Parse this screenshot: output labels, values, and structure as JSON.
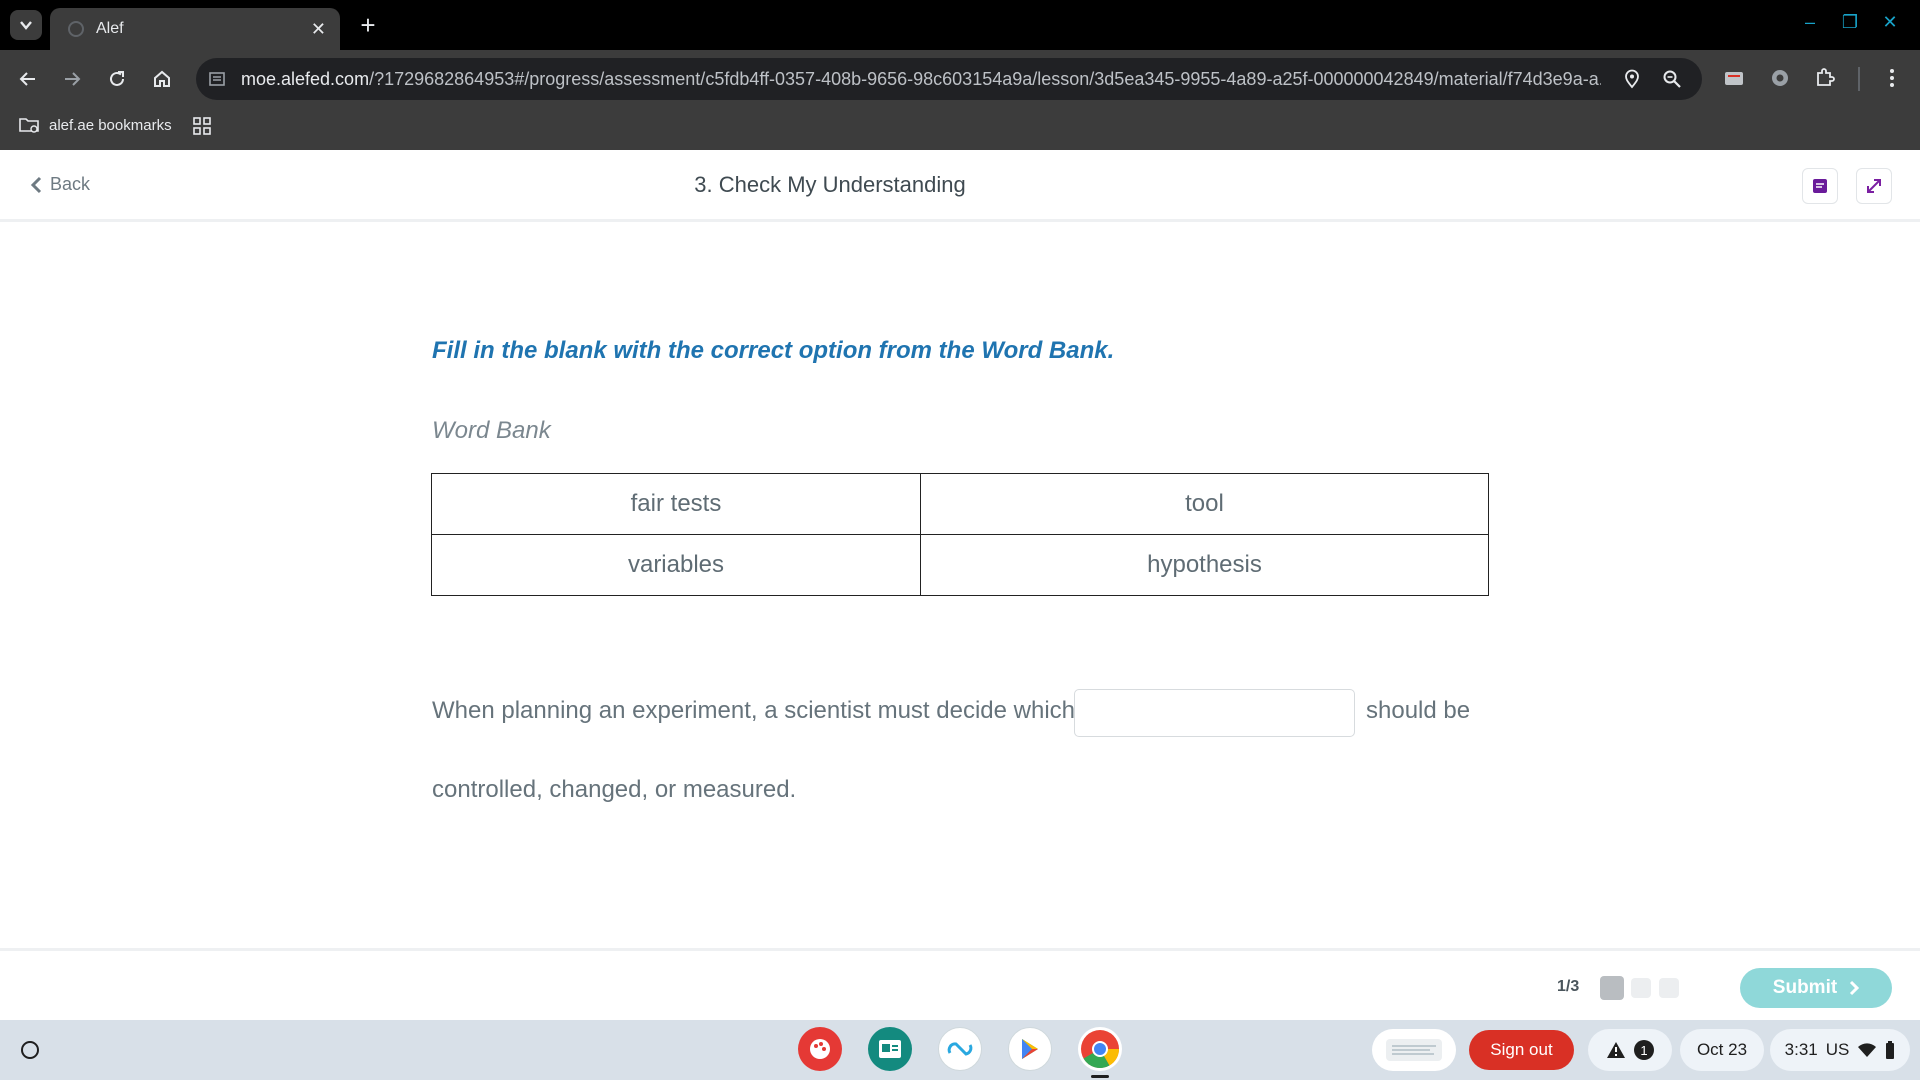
{
  "browser": {
    "tab_title": "Alef",
    "tab_close": "✕",
    "new_tab": "+",
    "url_host": "moe.alefed.com",
    "url_path": "/?1729682864953#/progress/assessment/c5fdb4ff-0357-408b-9656-98c603154a9a/lesson/3d5ea345-9955-4a89-a25f-000000042849/material/f74d3e9a-a...",
    "bookmark_folder": "alef.ae bookmarks",
    "window_controls": [
      "–",
      "❐",
      "✕"
    ]
  },
  "header": {
    "back_label": "Back",
    "title": "3. Check My Understanding"
  },
  "question": {
    "instruction": "Fill in the blank with the correct option from the Word Bank.",
    "word_bank_label": "Word Bank",
    "word_bank_rows": [
      [
        "fair tests",
        "tool"
      ],
      [
        "variables",
        "hypothesis"
      ]
    ],
    "sentence_part1": "When planning an experiment, a scientist must decide which",
    "blank_value": "",
    "sentence_part2": "should be",
    "sentence_part3": "controlled, changed, or measured."
  },
  "footer": {
    "pager": "1/3",
    "submit_label": "Submit",
    "current_page": 1,
    "total_pages": 3
  },
  "shelf": {
    "sign_out": "Sign out",
    "notification_count": "1",
    "date": "Oct 23",
    "time": "3:31",
    "locale": "US"
  },
  "colors": {
    "instruction_blue": "#1f74b0",
    "submit_teal": "#8fd8d9",
    "sign_out_red": "#d93025",
    "window_control_cyan": "#18a3c9"
  },
  "icons": [
    "tab-list-icon",
    "back-arrow-icon",
    "forward-arrow-icon",
    "reload-icon",
    "home-icon",
    "site-info-icon",
    "location-icon",
    "zoom-icon",
    "extension-icons",
    "menu-dots-icon",
    "apps-grid-icon",
    "chevron-left-icon",
    "immersive-reader-icon",
    "expand-icon",
    "chevron-right-icon",
    "launcher-icon",
    "warning-icon",
    "wifi-icon",
    "battery-icon"
  ]
}
